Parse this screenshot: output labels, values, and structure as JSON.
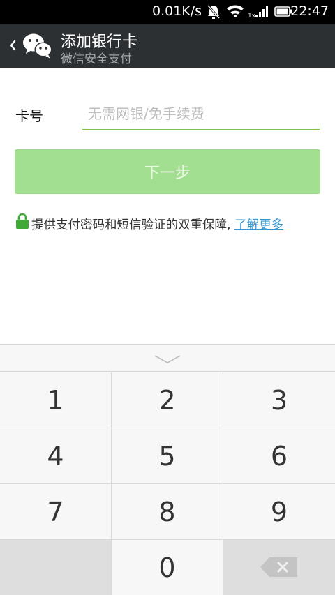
{
  "status_bar": {
    "speed": "0.01K/s",
    "time": "22:47",
    "signal_tag": "1x"
  },
  "header": {
    "title": "添加银行卡",
    "subtitle": "微信安全支付"
  },
  "form": {
    "card_label": "卡号",
    "card_placeholder": "无需网银/免手续费",
    "next_label": "下一步"
  },
  "notice": {
    "text": "提供支付密码和短信验证的双重保障, ",
    "link": "了解更多"
  },
  "keypad": {
    "keys": [
      "1",
      "2",
      "3",
      "4",
      "5",
      "6",
      "7",
      "8",
      "9",
      "0"
    ]
  },
  "colors": {
    "title_bar": "#2c3033",
    "accent_green": "#7ec14f",
    "button_green": "#a3df90",
    "link_blue": "#3596cf"
  }
}
